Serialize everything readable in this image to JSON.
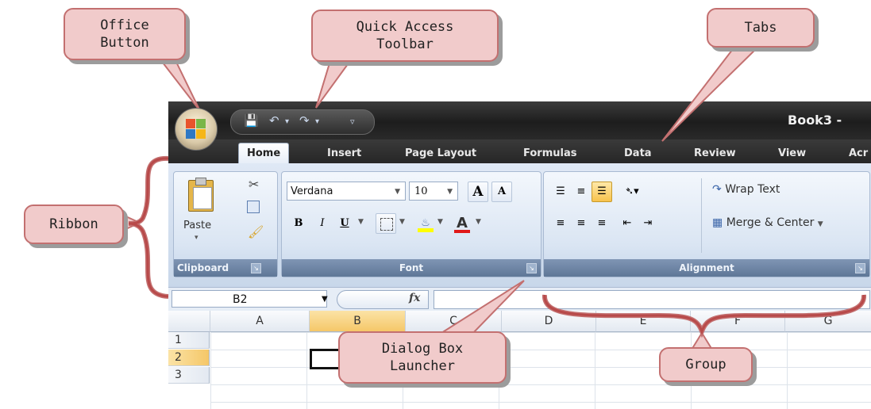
{
  "window": {
    "title": "Book3 - ",
    "qat": {
      "save_icon": "save-icon",
      "undo_icon": "undo-icon",
      "redo_icon": "redo-icon",
      "customize_icon": "customize-icon"
    },
    "tabs": [
      "Home",
      "Insert",
      "Page Layout",
      "Formulas",
      "Data",
      "Review",
      "View",
      "Acr"
    ],
    "active_tab": "Home"
  },
  "ribbon": {
    "clipboard": {
      "label": "Clipboard",
      "paste": "Paste"
    },
    "font": {
      "label": "Font",
      "font_name": "Verdana",
      "font_size": "10",
      "grow": "A",
      "shrink": "A",
      "bold": "B",
      "italic": "I",
      "underline": "U",
      "font_color": "A"
    },
    "alignment": {
      "label": "Alignment",
      "wrap_text": "Wrap Text",
      "merge_center": "Merge & Center"
    }
  },
  "formula_bar": {
    "name_box": "B2",
    "fx": "fx"
  },
  "sheet": {
    "columns": [
      "A",
      "B",
      "C",
      "D",
      "E",
      "F",
      "G"
    ],
    "rows": [
      "1",
      "2",
      "3"
    ]
  },
  "callouts": {
    "office_button": "Office\nButton",
    "qat": "Quick Access\nToolbar",
    "tabs": "Tabs",
    "ribbon": "Ribbon",
    "dialog_launcher": "Dialog Box\nLauncher",
    "group": "Group"
  },
  "colors": {
    "callout_fill": "#f1cbcb",
    "callout_border": "#c37070",
    "bracket": "#b84a4a"
  }
}
